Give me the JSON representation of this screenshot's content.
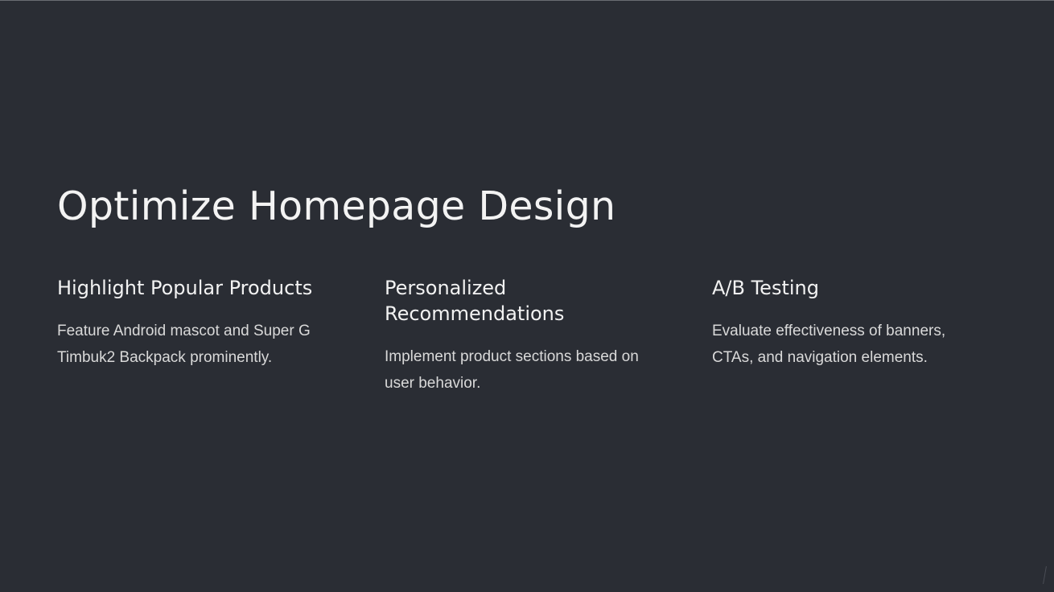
{
  "slide": {
    "title": "Optimize Homepage Design",
    "columns": [
      {
        "heading": "Highlight Popular Products",
        "text": "Feature Android mascot and Super G Timbuk2 Backpack prominently."
      },
      {
        "heading": "Personalized Recommendations",
        "text": "Implement product sections based on user behavior."
      },
      {
        "heading": "A/B Testing",
        "text": "Evaluate effectiveness of banners, CTAs, and navigation elements."
      }
    ]
  },
  "colors": {
    "background": "#2a2d34",
    "title_text": "#f3f3f3",
    "body_text": "#d9d9d9"
  }
}
